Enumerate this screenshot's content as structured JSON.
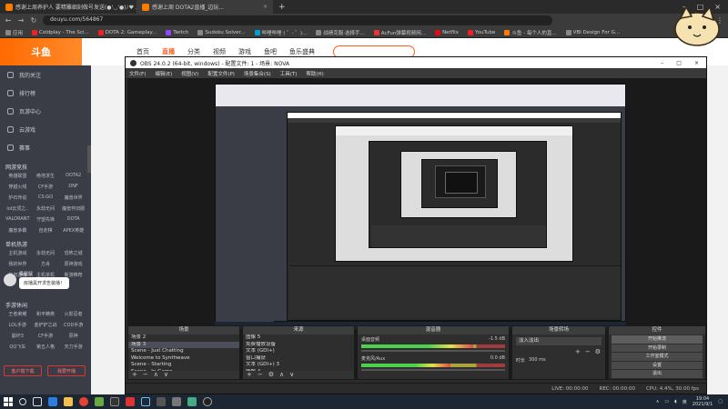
{
  "browser": {
    "tabs": [
      {
        "title": "感谢上周养护人 要精雕细刻做号发送(●'◡'●)ﾉ♥ ...",
        "active": false
      },
      {
        "title": "感谢上周 DOTA2直播_边玩...",
        "active": true
      }
    ],
    "new_tab": "+",
    "url": "douyu.com/564867",
    "bookmarks": [
      "应用",
      "Coldplay - The Sci...",
      "DOTA 2: Gameplay...",
      "Twitch",
      "Sudoku Solver...",
      "哔哩哔哩 ( ゜- ゜)...",
      "战绩克服·选择手...",
      "AcFun弹幕视频网...",
      "Netflix",
      "YouTube",
      "斗鱼 - 每个人的直...",
      "VBI Design For G..."
    ]
  },
  "site": {
    "logo": "斗鱼",
    "nav": [
      "首页",
      "直播",
      "分类",
      "视频",
      "游戏",
      "鱼吧",
      "鱼乐盛典"
    ],
    "nav_active": "直播",
    "sidebar": {
      "items": [
        "我的关注",
        "排行榜",
        "页游中心",
        "云游戏",
        "赛事"
      ],
      "section_live": "网游竞技",
      "live_grid": [
        "英雄联盟",
        "绝地求生",
        "DOTA2",
        "穿越火线",
        "CF手游",
        "DNF",
        "炉石传说",
        "CS:GO",
        "魔兽世界",
        "lol云顶之..",
        "永劫无间",
        "魔兽怀旧服",
        "VALORANT",
        "守望先锋",
        "DOTA",
        "魔兽争霸",
        "自走棋",
        "APEX英雄"
      ],
      "section_single": "单机热游",
      "single_grid": [
        "主机游戏",
        "永劫无间",
        "恐怖之城",
        "我的世界",
        "方舟",
        "原神游戏",
        "怀旧游戏",
        "主机单机",
        "新游推荐"
      ],
      "section_mobile": "手游休闲",
      "mobile_grid": [
        "王者荣耀",
        "和平精英",
        "火影忍者",
        "LOL手游",
        "金铲铲之战",
        "COD手游",
        "崩坏3",
        "CF手游",
        "原神",
        "QQ飞车",
        "第五人格",
        "天刀手游"
      ],
      "chat_user": "贵鼠鼠",
      "chat_text": "房播黑开求告装播！",
      "buttons": [
        "客户端下载",
        "我要开播"
      ]
    }
  },
  "obs": {
    "title": "OBS 24.0.2 (64-bit, windows) - 配置文件: 1 - 场景: NOVA",
    "menu": [
      "文件(F)",
      "编辑(E)",
      "视图(V)",
      "配置文件(P)",
      "场景集合(S)",
      "工具(T)",
      "帮助(H)"
    ],
    "docks": {
      "scenes": {
        "title": "场景",
        "items": [
          "场景 2",
          "场景 3",
          "Scene - Just Chatting",
          "Welcome to Synthwave",
          "Scene - Starting",
          "Scene - In Game"
        ],
        "selected": 1
      },
      "sources": {
        "title": "来源",
        "items": [
          "图像 5",
          "免费播放设备",
          "文本 (GDI+)",
          "窗口捕获",
          "文本 (GDI+) 3",
          "图像 4"
        ]
      },
      "mixer": {
        "title": "混音器",
        "channels": [
          {
            "name": "桌面音频",
            "db": "-1.5 dB",
            "level": 0.78
          },
          {
            "name": "麦克风/Aux",
            "db": "0.0 dB",
            "level": 0.62
          }
        ]
      },
      "transitions": {
        "title": "场景转场",
        "mode": "淡入淡出",
        "duration_label": "时长",
        "duration": "300 ms"
      },
      "controls": {
        "title": "控件",
        "buttons": [
          "开始推流",
          "开始录制",
          "工作室模式",
          "设置",
          "退出"
        ],
        "active": 0
      }
    },
    "status": {
      "live": "LIVE: 00:00:00",
      "rec": "REC: 00:00:00",
      "cpu": "CPU: 4.4%, 30.00 fps"
    }
  },
  "taskbar": {
    "time": "19:04",
    "date": "2021/9/1",
    "lang": "英"
  }
}
